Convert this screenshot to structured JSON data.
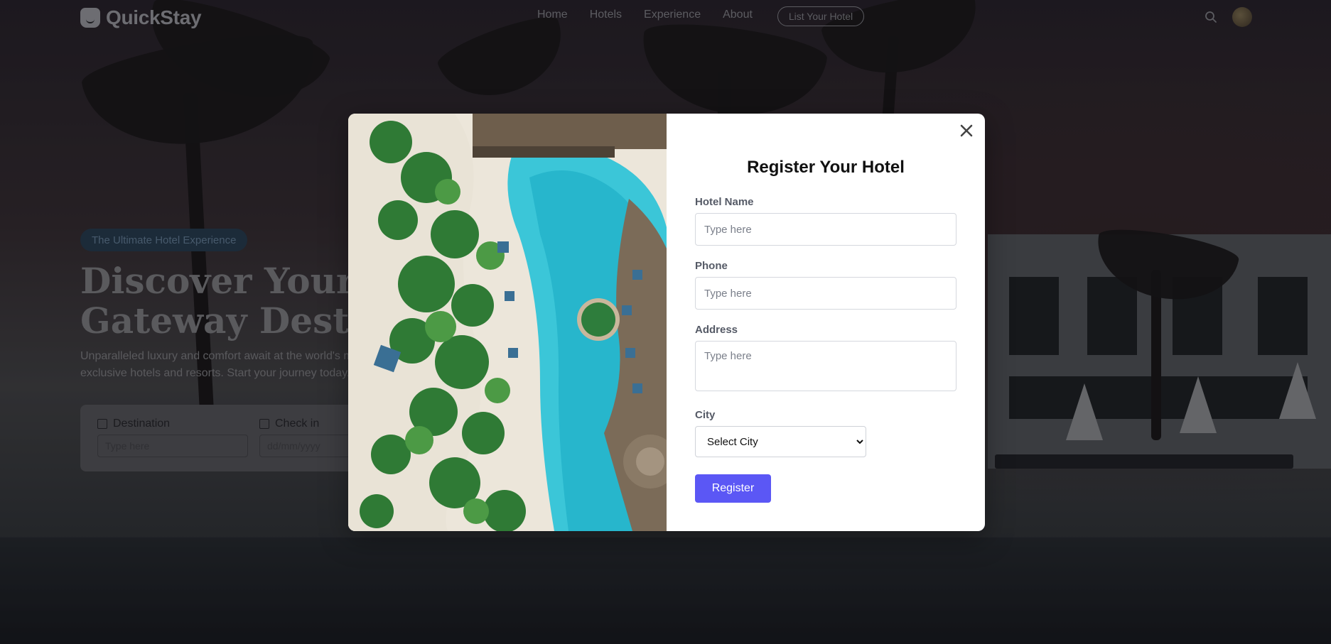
{
  "navbar": {
    "logo_text": "QuickStay",
    "links": [
      "Home",
      "Hotels",
      "Experience",
      "About"
    ],
    "list_hotel_label": "List Your Hotel"
  },
  "hero": {
    "badge": "The Ultimate Hotel Experience",
    "title": "Discover Your Perfect\nGateway Destination",
    "subtitle": "Unparalleled luxury and comfort await at the world's most exclusive hotels and resorts. Start your journey today.",
    "search": {
      "destination_label": "Destination",
      "destination_placeholder": "Type here",
      "checkin_label": "Check in",
      "checkin_placeholder": "dd/mm/yyyy"
    }
  },
  "modal": {
    "title": "Register Your Hotel",
    "fields": {
      "hotel_name_label": "Hotel Name",
      "hotel_name_placeholder": "Type here",
      "phone_label": "Phone",
      "phone_placeholder": "Type here",
      "address_label": "Address",
      "address_placeholder": "Type here",
      "city_label": "City",
      "city_selected": "Select City"
    },
    "register_label": "Register",
    "close_icon": "close-icon",
    "image_icon": "resort-pool-aerial-image"
  },
  "colors": {
    "accent": "#5b57f5",
    "badge_bg": "#2c4258"
  }
}
